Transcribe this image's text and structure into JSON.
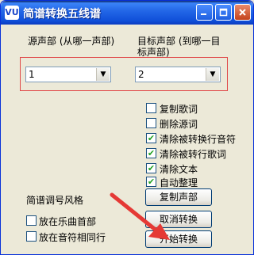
{
  "window": {
    "title": "简谱转换五线谱",
    "icon_text": "VU"
  },
  "labels": {
    "source_part": "源声部 (从哪一声部)",
    "target_part_line1": "目标声部 (到哪一目",
    "target_part_line2": "标声部)",
    "style_label": "简谱调号风格"
  },
  "combos": {
    "source": {
      "value": "1",
      "arrow": "▼"
    },
    "target": {
      "value": "2",
      "arrow": "▼"
    }
  },
  "options": [
    {
      "label": "复制歌词",
      "checked": false
    },
    {
      "label": "删除源词",
      "checked": false
    },
    {
      "label": "清除被转换行音符",
      "checked": true
    },
    {
      "label": "清除被转行歌词",
      "checked": true
    },
    {
      "label": "清除文本",
      "checked": true
    },
    {
      "label": "自动整理",
      "checked": true
    }
  ],
  "style_options": [
    {
      "label": "放在乐曲首部",
      "checked": false
    },
    {
      "label": "放在音符相同行",
      "checked": false
    }
  ],
  "buttons": {
    "copy_part": "复制声部",
    "cancel": "取消转换",
    "start": "开始转换"
  },
  "check_mark": "✔",
  "colors": {
    "annotation_arrow": "#E53935",
    "highlight_box": "#E04848"
  }
}
